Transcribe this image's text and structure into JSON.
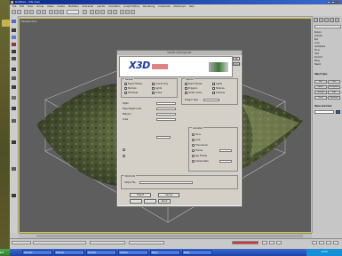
{
  "window": {
    "title": "Untitled - 3ds max",
    "menu": [
      "File",
      "Edit",
      "Tools",
      "Group",
      "Views",
      "Create",
      "Modifiers",
      "Character",
      "reactor",
      "Animation",
      "Graph Editors",
      "Rendering",
      "Customize",
      "MAXScript",
      "Help"
    ]
  },
  "viewport": {
    "label": "Perspective"
  },
  "dialog": {
    "title": "Vizx3D X3D Exporter",
    "logo_text": "X3D",
    "ok_label": "OK",
    "cancel_label": "Cancel",
    "groups": {
      "general": "General",
      "options": "Options",
      "anim": "Animation"
    },
    "checks_left": [
      "Export Hidden",
      "Normals",
      "Primitives"
    ],
    "checks_right": [
      "Coords Only",
      "Lights",
      "Indent"
    ],
    "opt_checks": [
      "Export Nodes",
      "Polygons",
      "Vertex Colors",
      "Lights",
      "Textures",
      "Cameras"
    ],
    "fields": [
      "Digits",
      "Edge Weight Units",
      "Material",
      "Scale"
    ],
    "polygon_type_label": "Polygon Type",
    "anim_radios": [
      "Once",
      "Loop",
      "Time Sensor",
      "Frames",
      "Key Frames",
      "Sample Rate"
    ],
    "world_info": "World Info",
    "output_label": "Output File",
    "bottom_buttons": [
      "Export",
      "Cancel",
      "About"
    ]
  },
  "command_panel": {
    "rows": [
      "Sphere",
      "Cylinder",
      "Box",
      "Cone",
      "GeoSphere",
      "Torus",
      "Tube",
      "Pyramid",
      "Plane",
      "Teapot"
    ],
    "section_labels": [
      "Object Type",
      "Name and Color"
    ],
    "btn_labels": [
      "Box",
      "Cone",
      "Sphere",
      "GeoSphere",
      "Cylinder",
      "Tube",
      "Torus",
      "Pyramid"
    ]
  },
  "taskbar": {
    "start_label": "start",
    "tasks": [
      "3ds max",
      "Explorer",
      "Exporter",
      "Capture",
      "Player",
      "Notes"
    ],
    "clock": "12:00"
  },
  "colors": {
    "viewport_bg": "#5e5e5e",
    "viewport_border": "#d8c838",
    "terrain_dark": "#2e3520",
    "terrain_light": "#7d8a52",
    "taskbar": "#2552c0"
  }
}
